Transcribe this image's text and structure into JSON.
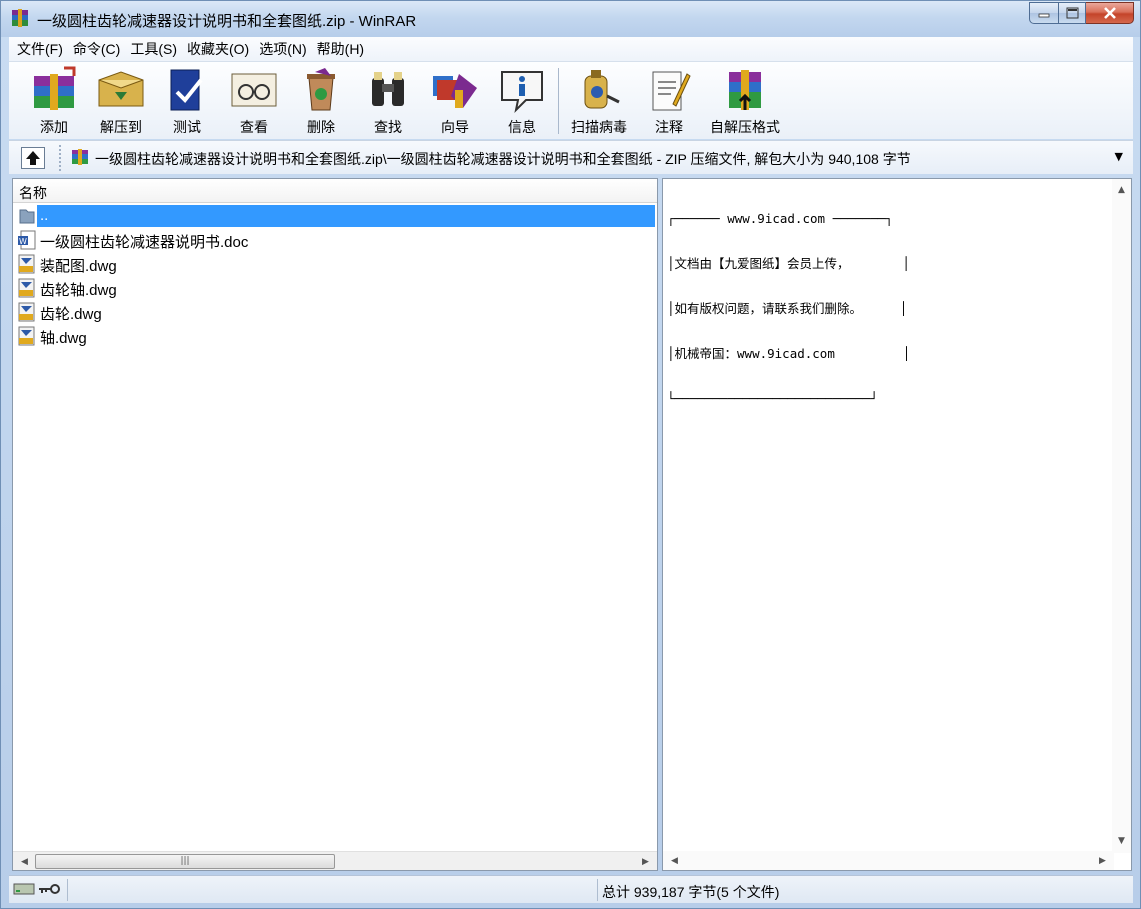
{
  "window": {
    "title": "一级圆柱齿轮减速器设计说明书和全套图纸.zip - WinRAR"
  },
  "menu": [
    "文件(F)",
    "命令(C)",
    "工具(S)",
    "收藏夹(O)",
    "选项(N)",
    "帮助(H)"
  ],
  "toolbar": [
    {
      "label": "添加",
      "icon": "add-archive-icon"
    },
    {
      "label": "解压到",
      "icon": "extract-to-icon"
    },
    {
      "label": "测试",
      "icon": "test-icon"
    },
    {
      "label": "查看",
      "icon": "view-icon"
    },
    {
      "label": "删除",
      "icon": "delete-icon"
    },
    {
      "label": "查找",
      "icon": "find-icon"
    },
    {
      "label": "向导",
      "icon": "wizard-icon"
    },
    {
      "label": "信息",
      "icon": "info-icon"
    },
    {
      "label": "扫描病毒",
      "icon": "virus-scan-icon"
    },
    {
      "label": "注释",
      "icon": "comment-icon"
    },
    {
      "label": "自解压格式",
      "icon": "sfx-icon"
    }
  ],
  "address": {
    "path": "一级圆柱齿轮减速器设计说明书和全套图纸.zip\\一级圆柱齿轮减速器设计说明书和全套图纸 - ZIP 压缩文件, 解包大小为 940,108 字节"
  },
  "file_list": {
    "column_header": "名称",
    "rows": [
      {
        "name": "..",
        "icon": "folder-up-icon",
        "selected": true
      },
      {
        "name": "一级圆柱齿轮减速器说明书.doc",
        "icon": "word-doc-icon",
        "selected": false
      },
      {
        "name": "装配图.dwg",
        "icon": "dwg-file-icon",
        "selected": false
      },
      {
        "name": "齿轮轴.dwg",
        "icon": "dwg-file-icon",
        "selected": false
      },
      {
        "name": "齿轮.dwg",
        "icon": "dwg-file-icon",
        "selected": false
      },
      {
        "name": "轴.dwg",
        "icon": "dwg-file-icon",
        "selected": false
      }
    ]
  },
  "comment_lines": [
    "┌────── www.9icad.com ───────┐",
    "│文档由【九爱图纸】会员上传，       │",
    "│如有版权问题，请联系我们删除。     │",
    "│机械帝国：www.9icad.com         │",
    "└──────────────────────────┘"
  ],
  "status": {
    "summary": "总计 939,187 字节(5 个文件)"
  },
  "colors": {
    "selection": "#3399ff",
    "frame": "#b7cde9"
  }
}
